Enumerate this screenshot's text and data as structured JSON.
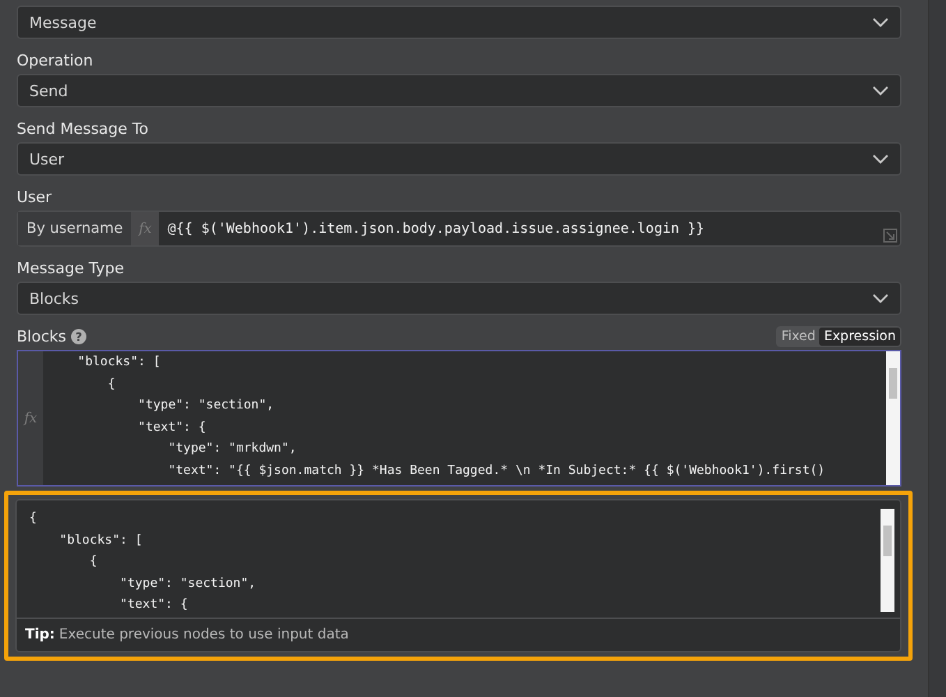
{
  "fields": [
    {
      "kind": "select",
      "value": "Message"
    },
    {
      "kind": "select",
      "label": "Operation",
      "value": "Send"
    },
    {
      "kind": "select",
      "label": "Send Message To",
      "value": "User"
    },
    {
      "kind": "locator",
      "label": "User",
      "mode": "By username",
      "fx": "fx",
      "value": "@{{ $('Webhook1').item.json.body.payload.issue.assignee.login }}"
    },
    {
      "kind": "select",
      "label": "Message Type",
      "value": "Blocks"
    },
    {
      "kind": "code",
      "label": "Blocks",
      "help": "?",
      "fx": "fx",
      "toggle": [
        {
          "label": "Fixed",
          "selected": false
        },
        {
          "label": "Expression",
          "selected": true
        }
      ],
      "editor_lines": [
        "    \"blocks\": [",
        "        {",
        "            \"type\": \"section\",",
        "            \"text\": {",
        "                \"type\": \"mrkdwn\",",
        "                \"text\": \"{{ $json.match }} *Has Been Tagged.* \\n *In Subject:* {{ $('Webhook1').first()"
      ],
      "preview_lines": [
        "{",
        "    \"blocks\": [",
        "        {",
        "            \"type\": \"section\",",
        "            \"text\": {"
      ],
      "tip_label": "Tip:",
      "tip": "Execute previous nodes to use input data",
      "highlighted": true
    }
  ]
}
